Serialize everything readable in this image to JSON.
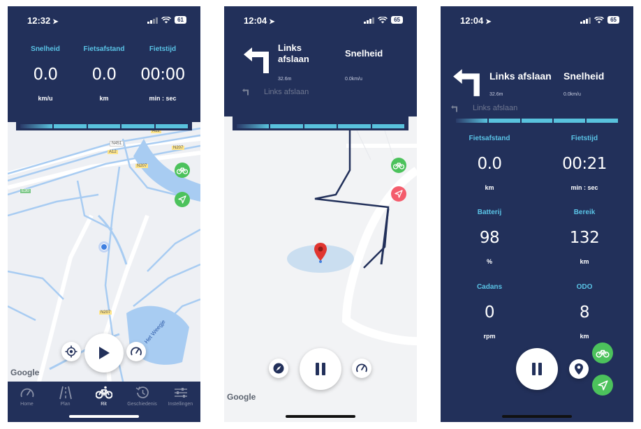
{
  "screen1": {
    "time": "12:32",
    "battery": "61",
    "labels": {
      "speed": "Snelheid",
      "distance": "Fietsafstand",
      "time": "Fietstijd"
    },
    "values": {
      "speed": "0.0",
      "distance": "0.0",
      "time": "00:00"
    },
    "units": {
      "speed": "km/u",
      "distance": "km",
      "time": "min : sec"
    },
    "map_labels": {
      "a12": "A12",
      "n451": "N451",
      "a12b": "A12",
      "n207a": "N207",
      "n207b": "N207",
      "e30": "E30",
      "n207c": "N207",
      "lake": "Het Weegje"
    },
    "google": "Google",
    "tabs": [
      {
        "label": "Home",
        "icon": "speedometer-icon"
      },
      {
        "label": "Plan",
        "icon": "road-icon"
      },
      {
        "label": "Rit",
        "icon": "bike-icon"
      },
      {
        "label": "Geschiedenis",
        "icon": "history-icon"
      },
      {
        "label": "Instellingen",
        "icon": "sliders-icon"
      }
    ]
  },
  "screen2": {
    "time": "12:04",
    "battery": "65",
    "instruction": "Links afslaan",
    "instruction_line1": "Links",
    "instruction_line2": "afslaan",
    "distance": "32.6m",
    "speed_label": "Snelheid",
    "speed_value": "0.0km/u",
    "next_instruction": "Links afslaan",
    "google": "Google"
  },
  "screen3": {
    "time": "12:04",
    "battery": "65",
    "instruction": "Links afslaan",
    "distance": "32.6m",
    "speed_label": "Snelheid",
    "speed_value": "0.0km/u",
    "next_instruction": "Links afslaan",
    "cards": [
      {
        "label": "Fietsafstand",
        "value": "0.0",
        "unit": "km"
      },
      {
        "label": "Fietstijd",
        "value": "00:21",
        "unit": "min : sec"
      },
      {
        "label": "Batterij",
        "value": "98",
        "unit": "%"
      },
      {
        "label": "Bereik",
        "value": "132",
        "unit": "km"
      },
      {
        "label": "Cadans",
        "value": "0",
        "unit": "rpm"
      },
      {
        "label": "ODO",
        "value": "8",
        "unit": "km"
      }
    ]
  },
  "colors": {
    "navy": "#22305a",
    "accent": "#5ac3e6",
    "green": "#4cc25c",
    "red": "#f45c6c"
  }
}
